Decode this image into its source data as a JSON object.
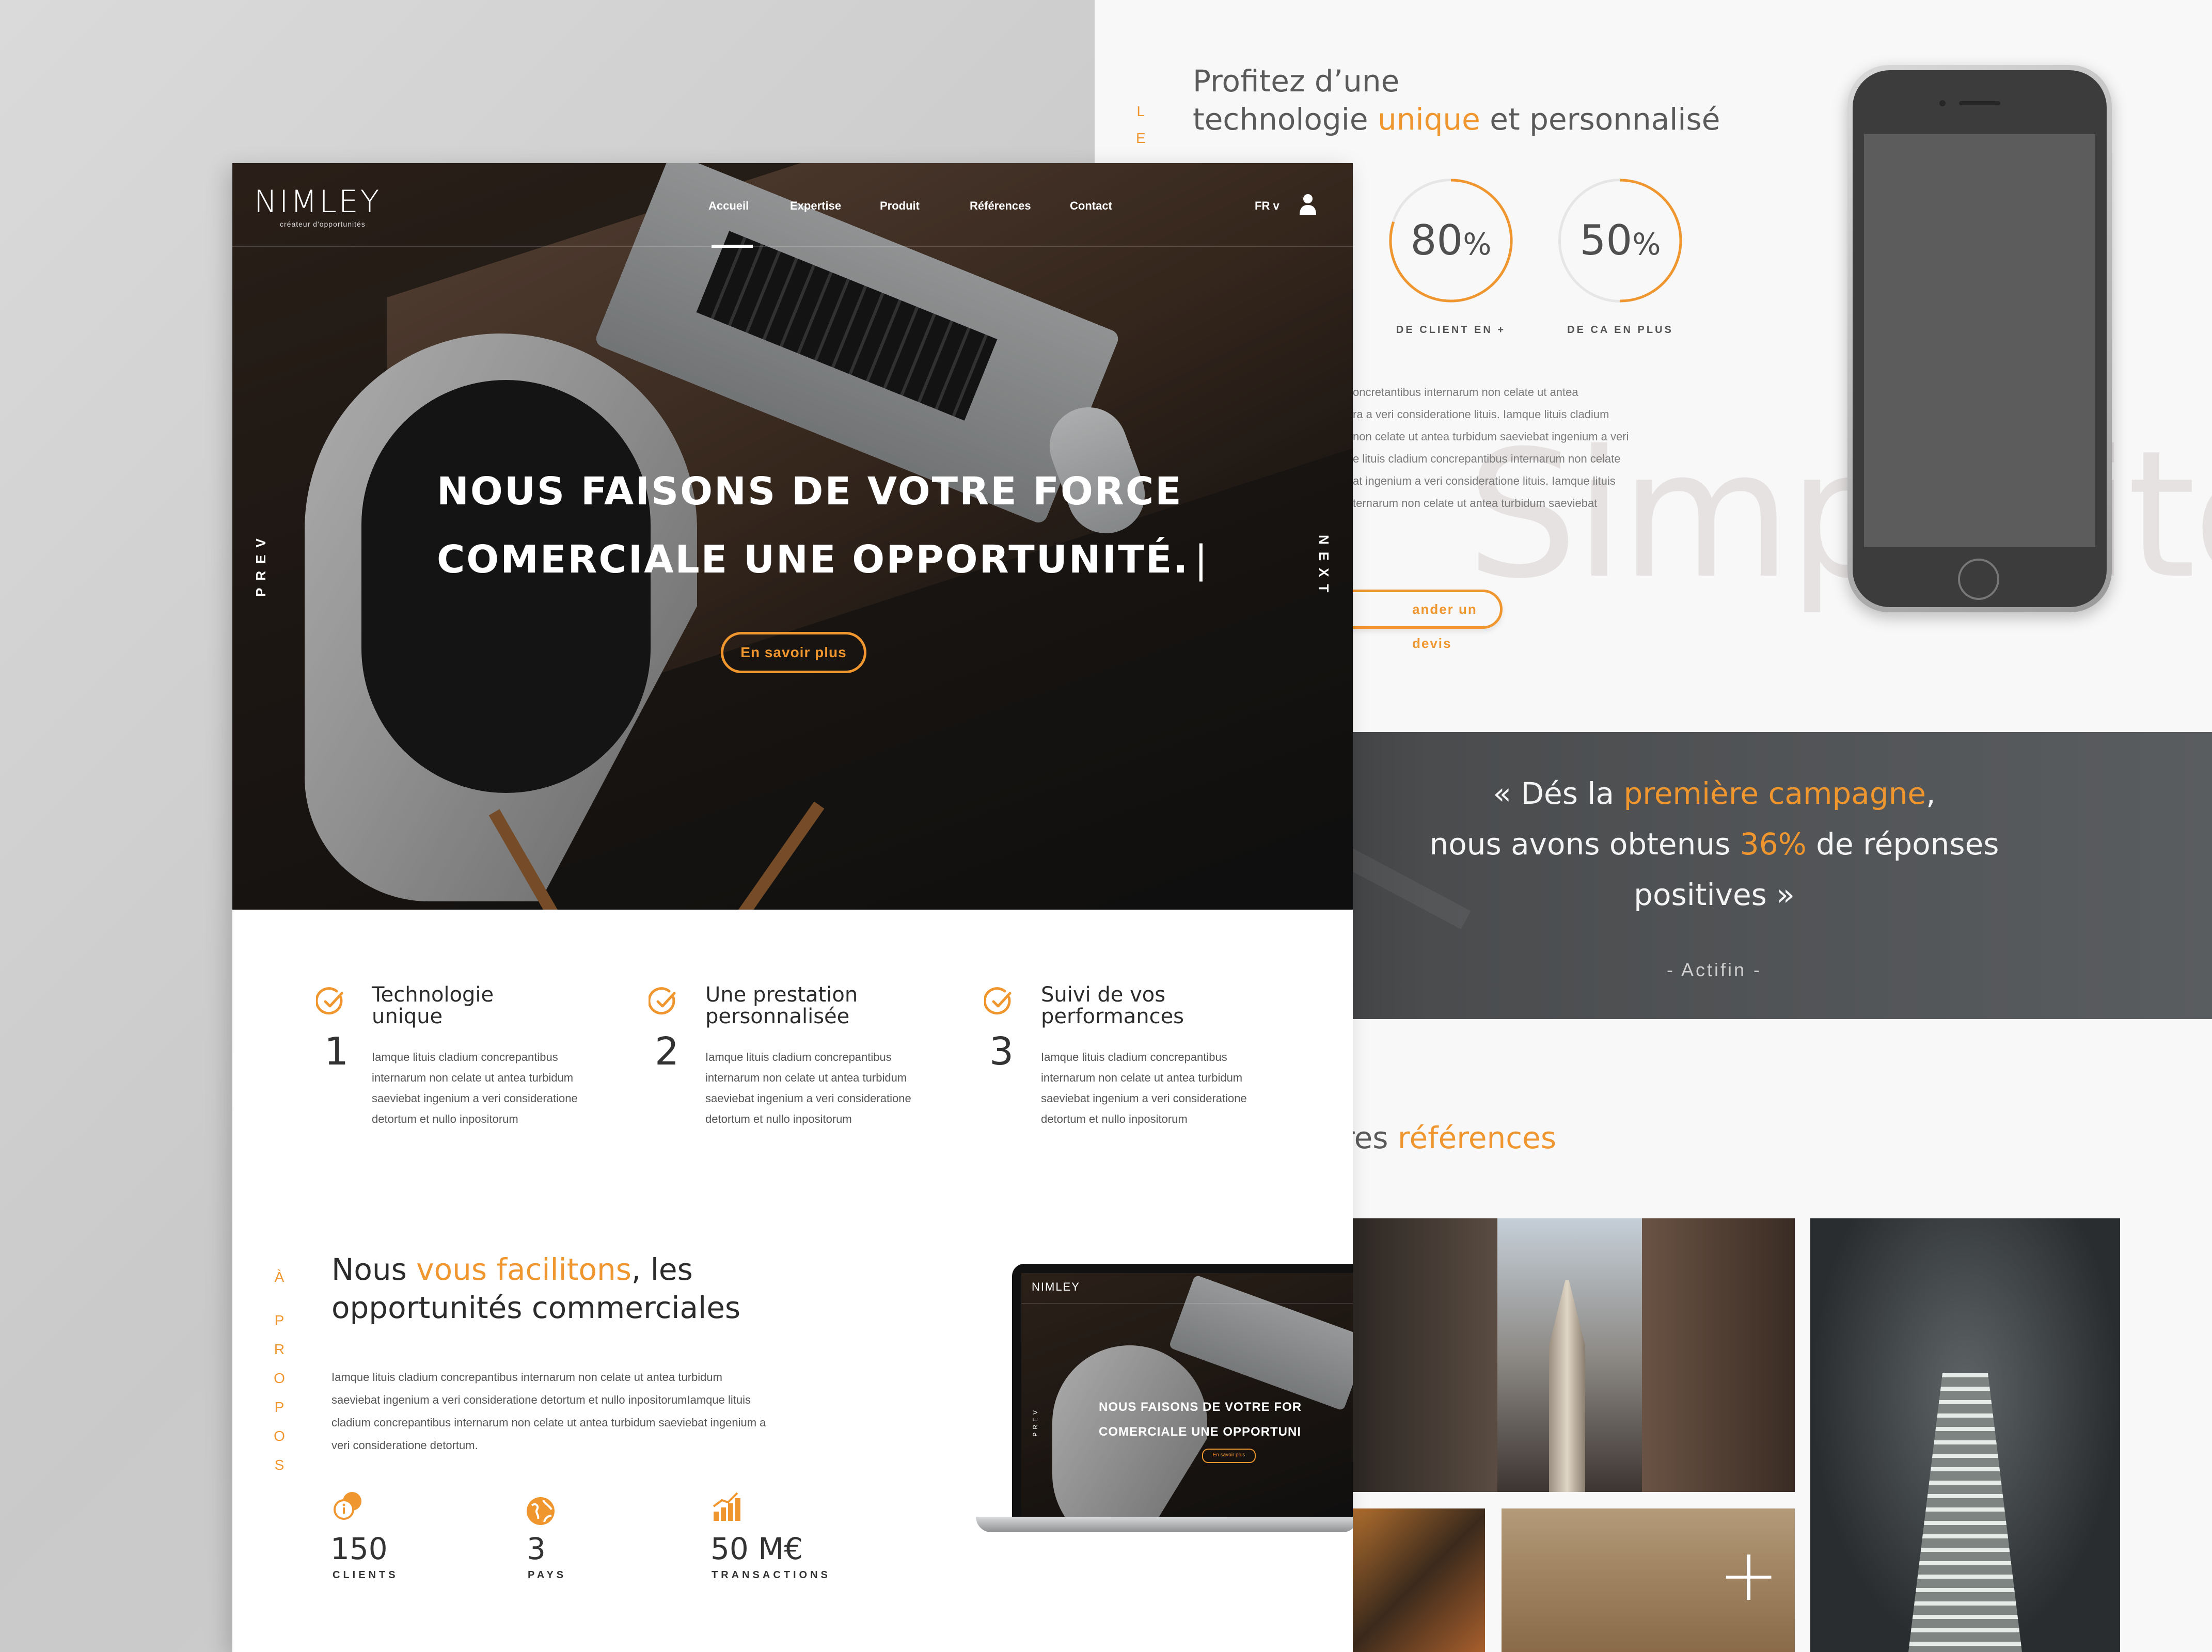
{
  "back": {
    "side_letters": [
      "L",
      "E"
    ],
    "title_line1": "Profitez d’une",
    "title_line2_pre": "technologie ",
    "title_line2_accent": "unique",
    "title_line2_post": " et personnalisé",
    "stats": [
      {
        "num": "80",
        "unit": "%",
        "label": "DE CLIENT EN +"
      },
      {
        "num": "50",
        "unit": "%",
        "label": "DE CA EN PLUS"
      }
    ],
    "lorem_lines": [
      "oncretantibus internarum non celate ut antea",
      "ra a veri consideratione lituis. Iamque lituis cladium",
      "non celate ut antea turbidum saeviebat ingenium a veri",
      "e lituis cladium concrepantibus internarum non celate",
      "at ingenium a veri consideratione lituis. Iamque lituis",
      "ternarum non celate ut antea turbidum saeviebat"
    ],
    "big_word": "Simplicité",
    "devis_label": "ander un devis",
    "testimonial": {
      "line1_pre": "« Dés la ",
      "line1_accent": "première campagne",
      "line1_post": ",",
      "line2_pre": "nous avons obtenus ",
      "line2_accent": "36%",
      "line2_post": " de réponses",
      "line3": "positives »",
      "author": "- Actifin -"
    },
    "references_pre": "res ",
    "references_accent": "références"
  },
  "front": {
    "logo": "NIMLEY",
    "logo_tagline": "créateur d'opportunités",
    "nav": [
      "Accueil",
      "Expertise",
      "Produit",
      "Références",
      "Contact"
    ],
    "lang": "FR v",
    "prev": "PREV",
    "next": "NEXT",
    "hero_line1": "NOUS FAISONS DE VOTRE  FORCE",
    "hero_line2": "COMERCIALE UNE OPPORTUNITÉ.",
    "hero_cta": "En savoir plus",
    "features": [
      {
        "title1": "Technologie",
        "title2": "unique",
        "num": "1",
        "text": [
          "Iamque lituis cladium concrepantibus",
          "internarum non celate ut antea turbidum",
          "saeviebat ingenium a veri consideratione",
          "detortum et nullo inpositorum"
        ]
      },
      {
        "title1": "Une prestation",
        "title2": "personnalisée",
        "num": "2",
        "text": [
          "Iamque lituis cladium concrepantibus",
          "internarum non celate ut antea turbidum",
          "saeviebat ingenium a veri consideratione",
          "detortum et nullo inpositorum"
        ]
      },
      {
        "title1": "Suivi de vos",
        "title2": "performances",
        "num": "3",
        "text": [
          "Iamque lituis cladium concrepantibus",
          "internarum non celate ut antea turbidum",
          "saeviebat ingenium a veri consideratione",
          "detortum et nullo inpositorum"
        ]
      }
    ],
    "apropos_letters": [
      "À",
      "P",
      "R",
      "O",
      "P",
      "O",
      "S"
    ],
    "about_pre": "Nous ",
    "about_accent": "vous facilitons",
    "about_post": ", les",
    "about_line2": "opportunités commerciales",
    "about_text": [
      "Iamque lituis cladium concrepantibus internarum non celate ut antea turbidum",
      "saeviebat ingenium a veri consideratione detortum et nullo inpositorumIamque lituis",
      "cladium concrepantibus internarum non celate ut antea turbidum saeviebat ingenium a",
      "veri consideratione detortum."
    ],
    "stats": [
      {
        "num": "150",
        "label": "CLIENTS",
        "icon": "chat-info-icon"
      },
      {
        "num": "3",
        "label": "PAYS",
        "icon": "globe-icon"
      },
      {
        "num": "50 M€",
        "label": "TRANSACTIONS",
        "icon": "growth-chart-icon"
      }
    ],
    "mini": {
      "logo": "NIMLEY",
      "line1": "NOUS FAISONS DE VOTRE  FOR",
      "line2": "COMERCIALE UNE OPPORTUNI",
      "cta": "En savoir plus",
      "prev": "PREV"
    }
  },
  "colors": {
    "accent": "#f0962f",
    "dark_text": "#2b2b2b",
    "hero_dark": "#1e1a17"
  }
}
